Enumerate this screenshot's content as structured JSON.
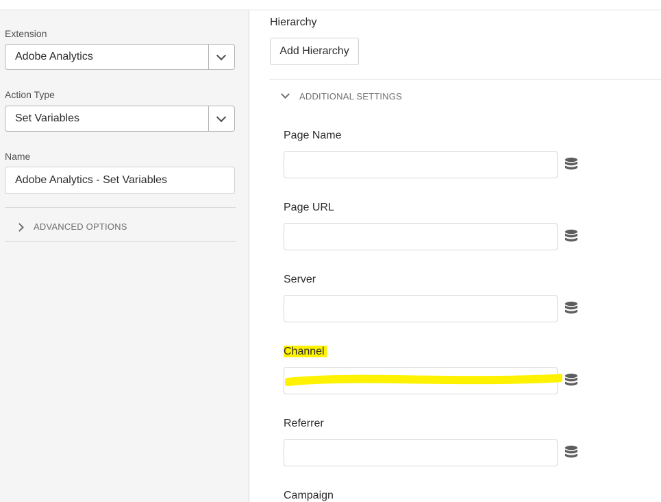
{
  "extension": {
    "label": "Extension",
    "value": "Adobe Analytics"
  },
  "action_type": {
    "label": "Action Type",
    "value": "Set Variables"
  },
  "name_field": {
    "label": "Name",
    "value": "Adobe Analytics - Set Variables"
  },
  "advanced_options": {
    "label": "ADVANCED OPTIONS"
  },
  "hierarchy": {
    "label": "Hierarchy",
    "button_label": "Add Hierarchy"
  },
  "additional_settings": {
    "label": "ADDITIONAL SETTINGS",
    "fields": [
      {
        "label": "Page Name",
        "value": ""
      },
      {
        "label": "Page URL",
        "value": ""
      },
      {
        "label": "Server",
        "value": ""
      },
      {
        "label": "Channel",
        "value": ""
      },
      {
        "label": "Referrer",
        "value": ""
      },
      {
        "label": "Campaign",
        "value": ""
      }
    ]
  },
  "icons": {
    "data_element": "database-icon",
    "dropdown": "chevron-down-icon",
    "collapsed": "chevron-right-icon"
  },
  "colors": {
    "highlight": "#fff200",
    "panel_bg": "#f5f5f5"
  }
}
